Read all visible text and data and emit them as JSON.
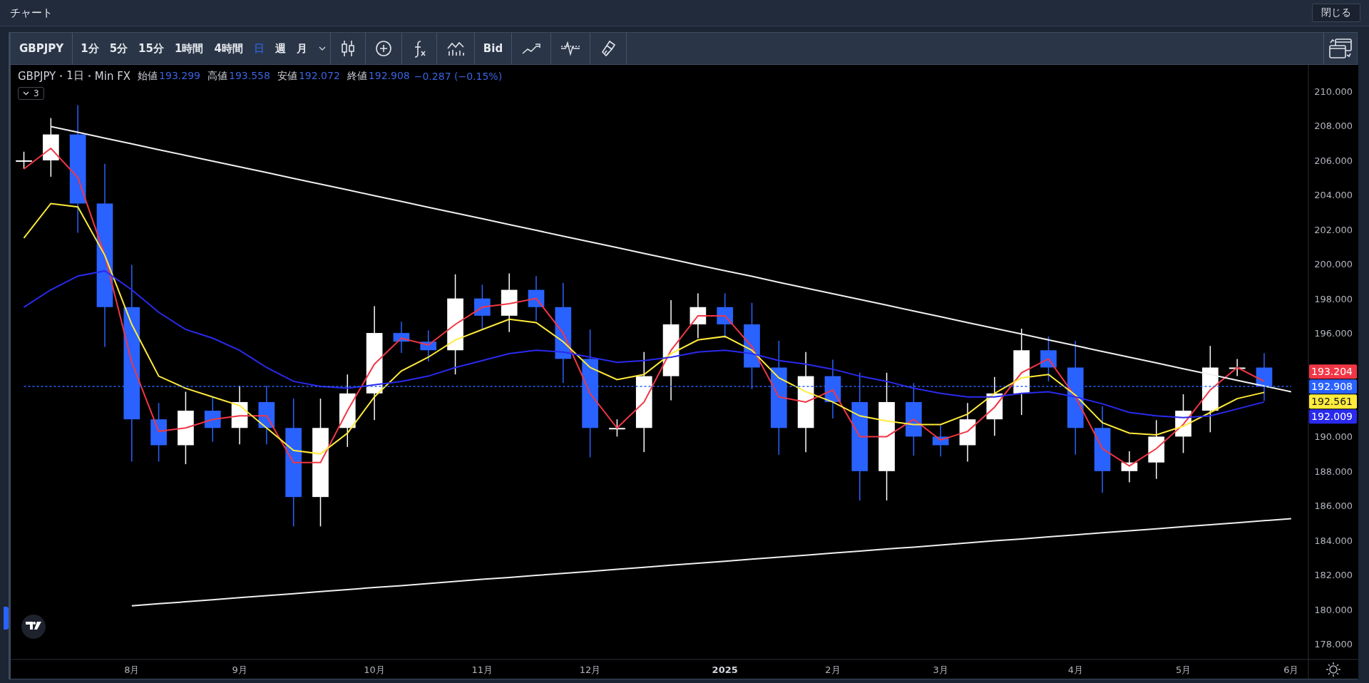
{
  "window": {
    "title": "チャート",
    "close_button": "閉じる"
  },
  "toolbar": {
    "symbol": "GBPJPY",
    "intervals": [
      {
        "label": "1分",
        "selected": false
      },
      {
        "label": "5分",
        "selected": false
      },
      {
        "label": "15分",
        "selected": false
      },
      {
        "label": "1時間",
        "selected": false
      },
      {
        "label": "4時間",
        "selected": false
      },
      {
        "label": "日",
        "selected": true
      },
      {
        "label": "週",
        "selected": false
      },
      {
        "label": "月",
        "selected": false
      }
    ],
    "bid": "Bid"
  },
  "legend": {
    "symbol": "GBPJPY",
    "interval": "1日",
    "source": "Min FX",
    "values": [
      {
        "label": "始値",
        "value": "193.299"
      },
      {
        "label": "高値",
        "value": "193.558"
      },
      {
        "label": "安値",
        "value": "192.072"
      },
      {
        "label": "終値",
        "value": "192.908"
      }
    ],
    "change": "−0.287 (−0.15%)",
    "indicator_count": "3"
  },
  "chart": {
    "chart_data": {
      "type": "line",
      "categories": [
        null,
        null,
        null,
        null,
        "8月",
        null,
        null,
        null,
        "9月",
        null,
        null,
        null,
        null,
        "10月",
        null,
        null,
        null,
        "11月",
        null,
        null,
        null,
        "12月",
        null,
        null,
        null,
        null,
        "2025",
        null,
        null,
        null,
        "2月",
        null,
        null,
        null,
        "3月",
        null,
        null,
        null,
        null,
        "4月",
        null,
        null,
        null,
        "5月",
        null,
        null,
        null,
        "6月"
      ],
      "series": [
        {
          "color": "#f23645",
          "values": [
            205.5,
            206.7,
            205.0,
            200.5,
            194.3,
            190.3,
            190.5,
            191.0,
            191.2,
            191.2,
            188.5,
            188.5,
            191.5,
            194.2,
            195.7,
            195.3,
            196.5,
            197.5,
            197.7,
            198.0,
            196.0,
            192.5,
            190.5,
            192.0,
            195.0,
            197.0,
            197.0,
            195.2,
            192.3,
            192.0,
            192.7,
            190.0,
            190.0,
            191.0,
            189.8,
            190.3,
            191.7,
            193.7,
            194.5,
            192.3,
            189.3,
            188.3,
            189.3,
            190.7,
            192.7,
            194.0,
            193.2,
            null
          ]
        },
        {
          "color": "#ffeb3b",
          "values": [
            201.5,
            203.5,
            203.3,
            200.5,
            196.5,
            193.5,
            192.8,
            192.3,
            191.8,
            190.5,
            189.2,
            189.0,
            190.2,
            192.3,
            193.8,
            194.6,
            195.6,
            196.2,
            196.8,
            196.6,
            195.5,
            194.0,
            193.3,
            193.6,
            194.8,
            195.6,
            195.8,
            195.0,
            193.4,
            192.6,
            192.0,
            191.2,
            190.9,
            190.7,
            190.7,
            191.3,
            192.5,
            193.4,
            193.6,
            192.4,
            190.8,
            190.2,
            190.1,
            190.6,
            191.4,
            192.2,
            192.56,
            null
          ]
        },
        {
          "color": "#2a2aef",
          "values": [
            197.5,
            198.5,
            199.3,
            199.6,
            198.5,
            197.2,
            196.2,
            195.7,
            195.0,
            194.0,
            193.2,
            192.9,
            192.8,
            193.0,
            193.2,
            193.5,
            194.0,
            194.4,
            194.8,
            195.0,
            194.9,
            194.6,
            194.3,
            194.4,
            194.6,
            194.9,
            195.0,
            194.8,
            194.4,
            194.2,
            193.9,
            193.5,
            193.2,
            192.8,
            192.5,
            192.3,
            192.3,
            192.5,
            192.6,
            192.3,
            191.9,
            191.4,
            191.2,
            191.1,
            191.2,
            191.6,
            192.0,
            null
          ]
        },
        {
          "color": "#f0f0f0",
          "values": [
            null,
            207.96,
            207.63,
            207.29,
            206.96,
            206.62,
            206.29,
            205.96,
            205.62,
            205.29,
            204.95,
            204.62,
            204.29,
            203.95,
            203.62,
            203.28,
            202.95,
            202.62,
            202.28,
            201.95,
            201.61,
            201.28,
            200.95,
            200.61,
            200.28,
            199.94,
            199.61,
            199.28,
            198.94,
            198.61,
            198.27,
            197.94,
            197.61,
            197.27,
            196.94,
            196.6,
            196.27,
            195.94,
            195.6,
            195.27,
            194.93,
            194.6,
            194.27,
            193.93,
            193.6,
            193.26,
            192.93,
            192.6
          ]
        },
        {
          "color": "#f0f0f0",
          "values": [
            null,
            null,
            null,
            null,
            180.2,
            180.32,
            180.43,
            180.55,
            180.67,
            180.79,
            180.9,
            181.02,
            181.14,
            181.26,
            181.37,
            181.49,
            181.61,
            181.73,
            181.84,
            181.96,
            182.08,
            182.19,
            182.31,
            182.43,
            182.55,
            182.66,
            182.78,
            182.9,
            183.02,
            183.13,
            183.25,
            183.37,
            183.49,
            183.6,
            183.72,
            183.84,
            183.96,
            184.07,
            184.19,
            184.31,
            184.43,
            184.54,
            184.66,
            184.78,
            184.9,
            185.01,
            185.13,
            185.25
          ]
        },
        {
          "color": "#2962ff",
          "line_style": "dotted",
          "values": [
            192.9,
            192.9,
            192.9,
            192.9,
            192.9,
            192.9,
            192.9,
            192.9,
            192.9,
            192.9,
            192.9,
            192.9,
            192.9,
            192.9,
            192.9,
            192.9,
            192.9,
            192.9,
            192.9,
            192.9,
            192.9,
            192.9,
            192.9,
            192.9,
            192.9,
            192.9,
            192.9,
            192.9,
            192.9,
            192.9,
            192.9,
            192.9,
            192.9,
            192.9,
            192.9,
            192.9,
            192.9,
            192.9,
            192.9,
            192.9,
            192.9,
            192.9,
            192.9,
            192.9,
            192.9,
            192.9,
            192.9,
            192.9
          ]
        }
      ],
      "ylim": [
        177.09,
        211.53
      ],
      "yticks": [
        {
          "value": 178,
          "label": "178.000"
        },
        {
          "value": 180,
          "label": "180.000"
        },
        {
          "value": 182,
          "label": "182.000"
        },
        {
          "value": 184,
          "label": "184.000"
        },
        {
          "value": 186,
          "label": "186.000"
        },
        {
          "value": 188,
          "label": "188.000"
        },
        {
          "value": 190,
          "label": "190.000"
        },
        {
          "value": 196,
          "label": "196.000"
        },
        {
          "value": 198,
          "label": "198.000"
        },
        {
          "value": 200,
          "label": "200.000"
        },
        {
          "value": 202,
          "label": "202.000"
        },
        {
          "value": 204,
          "label": "204.000"
        },
        {
          "value": 206,
          "label": "206.000"
        },
        {
          "value": 208,
          "label": "208.000"
        },
        {
          "value": 210,
          "label": "210.000"
        }
      ]
    },
    "price_labels": [
      {
        "value": "193.204",
        "color": "#f23645"
      },
      {
        "value": "192.908",
        "color": "#2962ff"
      },
      {
        "value": "192.561",
        "color": "#ffeb3b"
      },
      {
        "value": "192.009",
        "color": "#2a2aef"
      }
    ]
  }
}
